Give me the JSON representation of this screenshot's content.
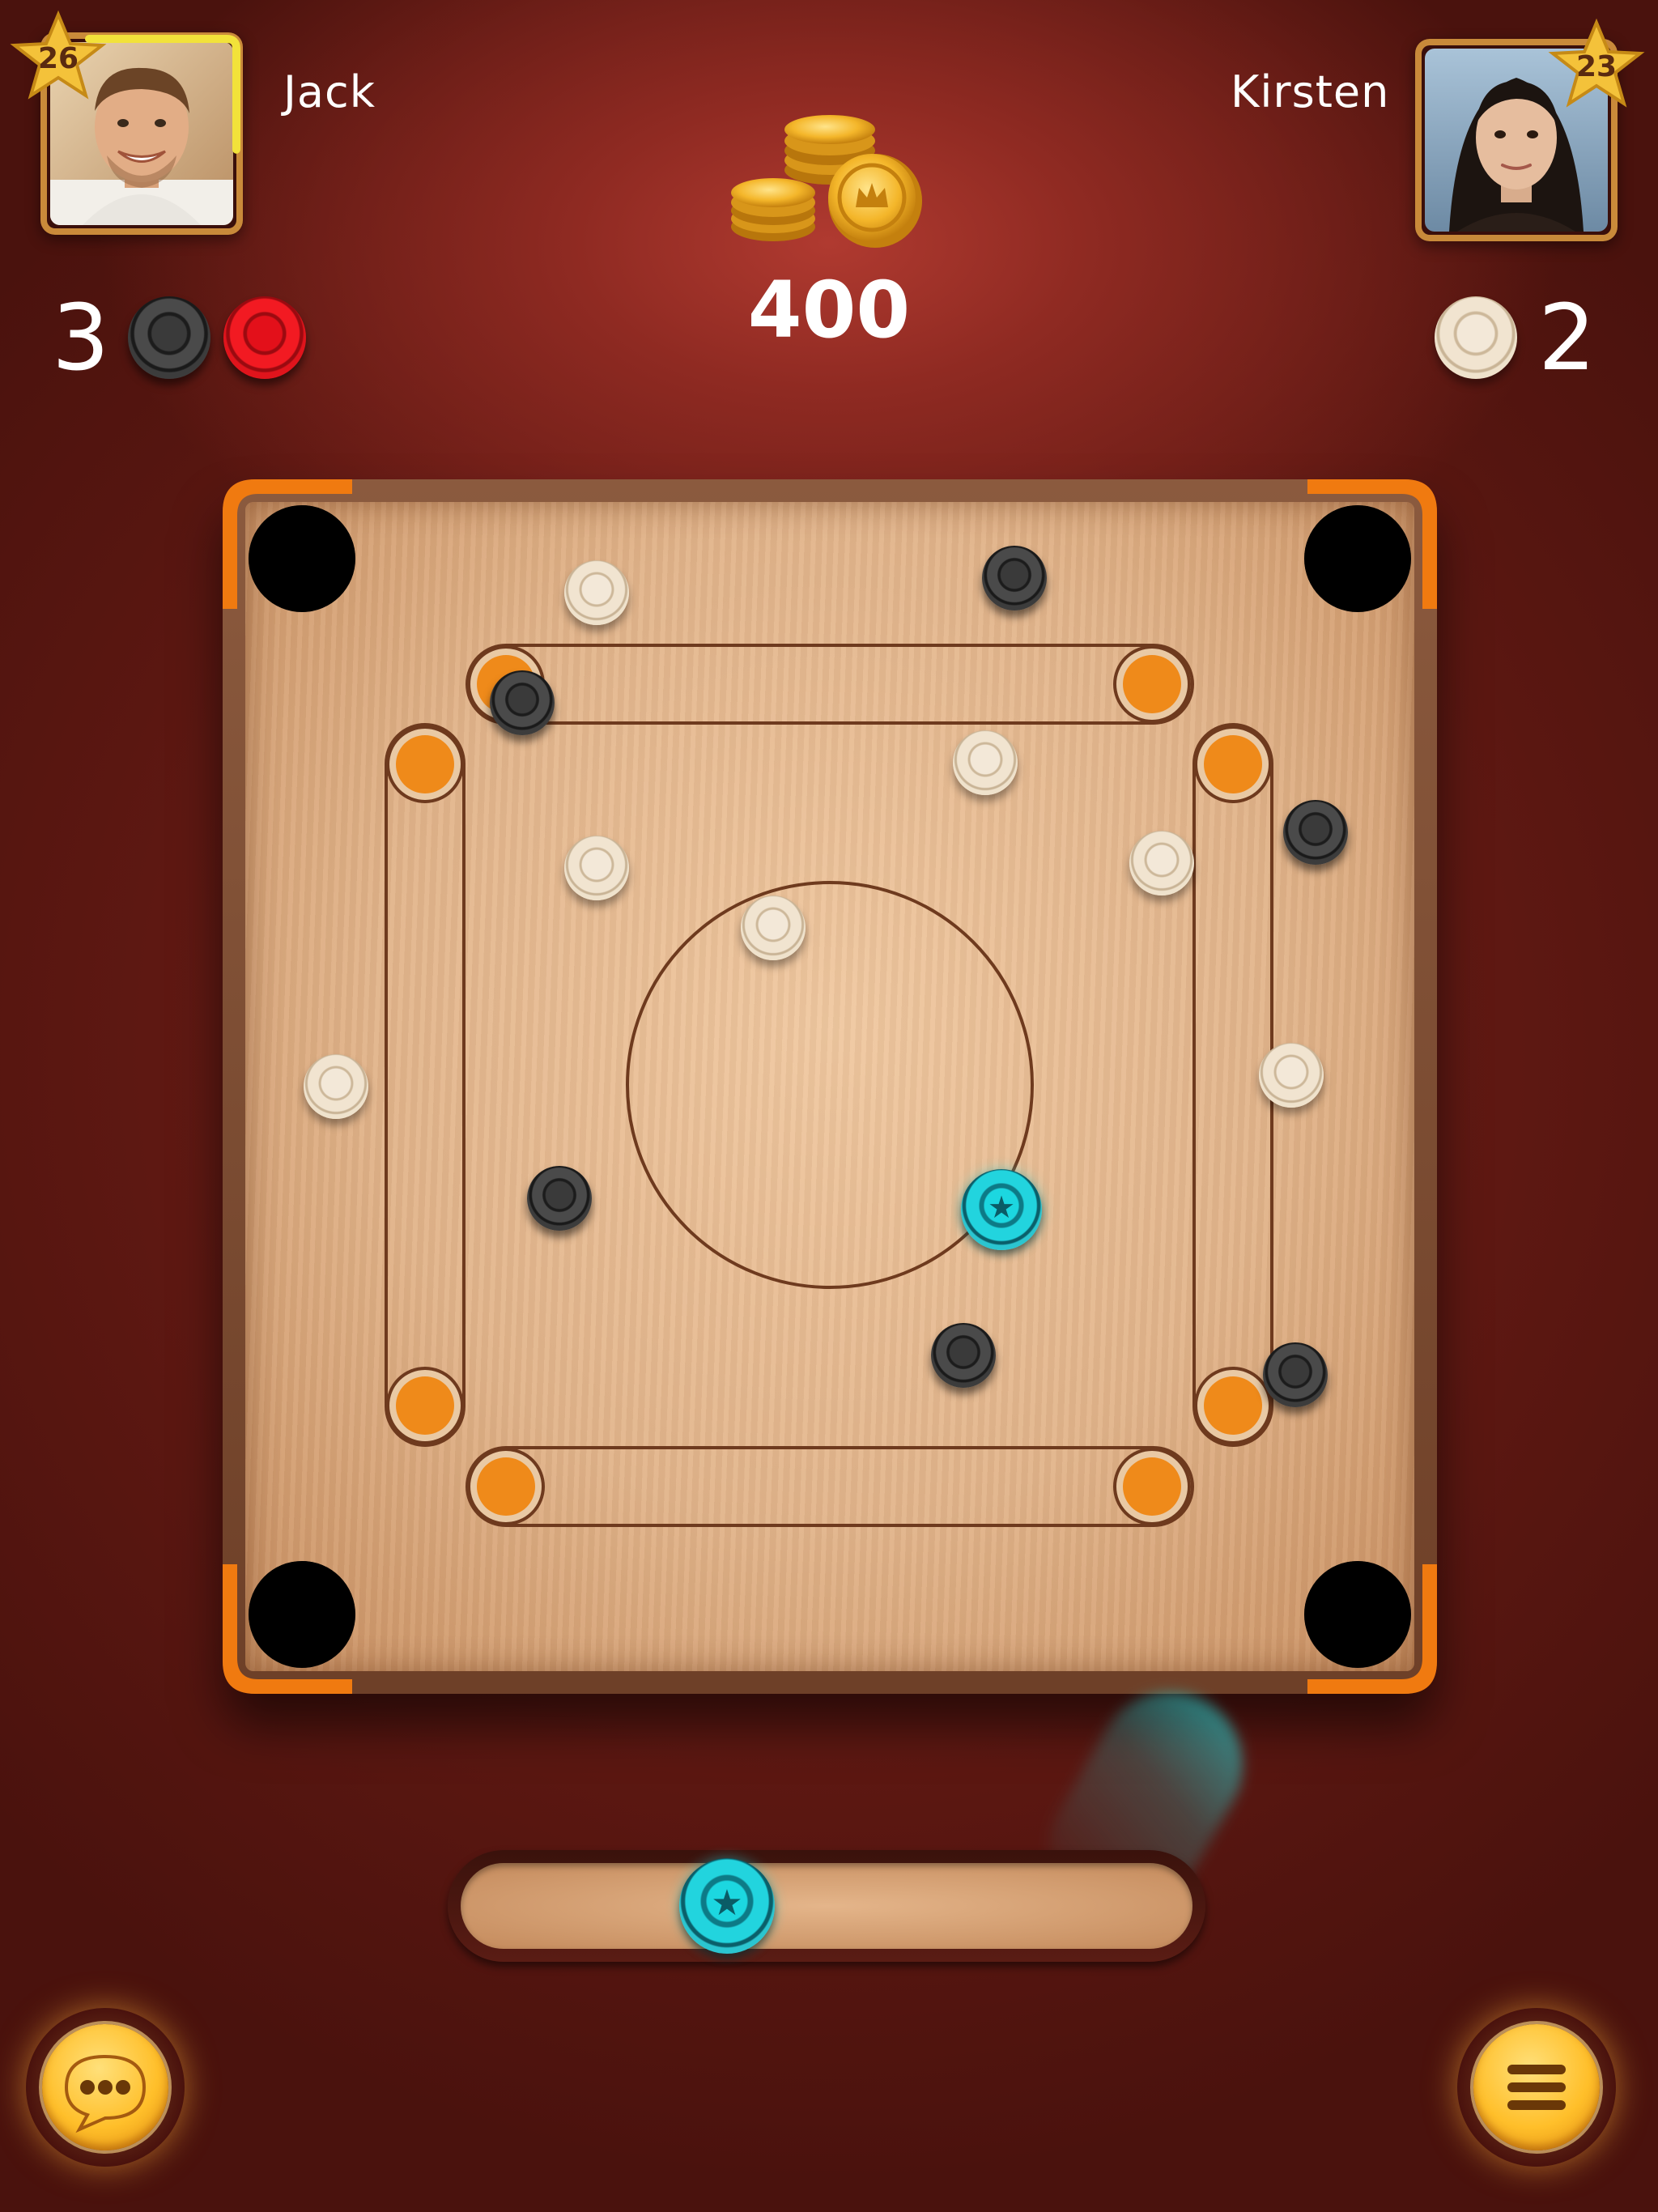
{
  "player_left": {
    "name": "Jack",
    "level": "26",
    "score": "3",
    "level_progress": 0.85,
    "pocketed": [
      "black",
      "red"
    ]
  },
  "player_right": {
    "name": "Kirsten",
    "level": "23",
    "score": "2",
    "pocketed": [
      "white"
    ]
  },
  "pot": {
    "value": "400",
    "icon": "coin-stack-icon"
  },
  "board": {
    "pieces": [
      {
        "color": "white",
        "name": "piece-white"
      },
      {
        "color": "black",
        "name": "piece-black"
      },
      {
        "color": "black",
        "name": "piece-black"
      },
      {
        "color": "white",
        "name": "piece-white"
      },
      {
        "color": "black",
        "name": "piece-black"
      },
      {
        "color": "white",
        "name": "piece-white"
      },
      {
        "color": "white",
        "name": "piece-white"
      },
      {
        "color": "white",
        "name": "piece-white"
      },
      {
        "color": "white",
        "name": "piece-white"
      },
      {
        "color": "white",
        "name": "piece-white"
      },
      {
        "color": "black",
        "name": "piece-black"
      },
      {
        "color": "black",
        "name": "piece-black"
      },
      {
        "color": "black",
        "name": "piece-black"
      }
    ],
    "striker": "striker-star-icon"
  },
  "controls": {
    "chat_icon": "chat-bubble-icon",
    "menu_icon": "hamburger-menu-icon"
  },
  "colors": {
    "accent_orange": "#f07a10",
    "striker_cyan": "#1cd7e0",
    "button_gold": "#ffbf2a",
    "background": "#7a221b"
  }
}
